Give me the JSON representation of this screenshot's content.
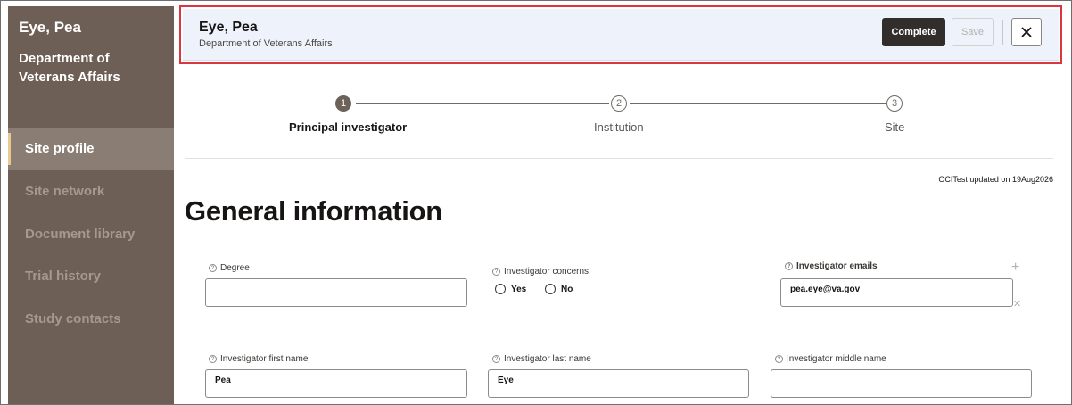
{
  "sidebar": {
    "name": "Eye, Pea",
    "organization": "Department of Veterans Affairs",
    "items": [
      {
        "label": "Site profile"
      },
      {
        "label": "Site network"
      },
      {
        "label": "Document library"
      },
      {
        "label": "Trial history"
      },
      {
        "label": "Study contacts"
      }
    ],
    "active_item": "Site profile"
  },
  "header": {
    "title": "Eye, Pea",
    "subtitle": "Department of Veterans Affairs",
    "complete_label": "Complete",
    "save_label": "Save",
    "close_icon": "close-icon"
  },
  "stepper": {
    "steps": [
      {
        "number": "1",
        "label": "Principal investigator",
        "active": true
      },
      {
        "number": "2",
        "label": "Institution",
        "active": false
      },
      {
        "number": "3",
        "label": "Site",
        "active": false
      }
    ]
  },
  "updated_text": "OCITest updated on 19Aug2026",
  "page_title": "General information",
  "form": {
    "help_icon_glyph": "?",
    "degree": {
      "label": "Degree",
      "value": ""
    },
    "concerns": {
      "label": "Investigator concerns",
      "options": [
        "Yes",
        "No"
      ]
    },
    "emails": {
      "label": "Investigator emails",
      "value": "pea.eye@va.gov",
      "add_icon": "plus-icon",
      "remove_icon": "remove-icon"
    },
    "first_name": {
      "label": "Investigator first name",
      "value": "Pea"
    },
    "last_name": {
      "label": "Investigator last name",
      "value": "Eye"
    },
    "middle_name": {
      "label": "Investigator middle name",
      "value": ""
    }
  },
  "colors": {
    "sidebar_bg": "#6d5f55",
    "sidebar_active_bg": "#8a7d74",
    "header_highlight": "#d9363e",
    "header_bg": "#eef2fb",
    "primary_button": "#312d2a"
  }
}
